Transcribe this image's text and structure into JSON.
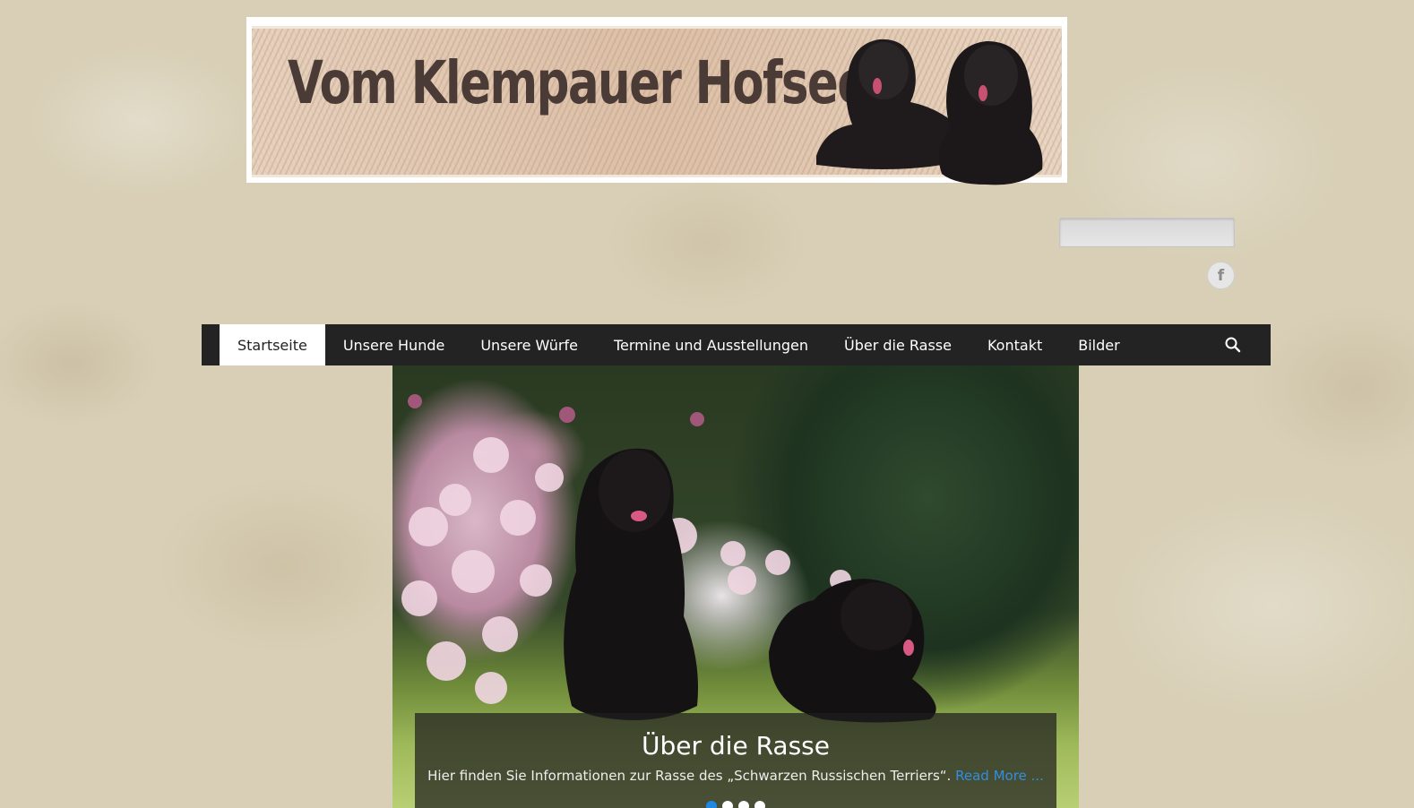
{
  "header": {
    "banner_title": "Vom Klempauer Hofsee",
    "logo": "dogs-banner-logo"
  },
  "search": {
    "placeholder": ""
  },
  "social": {
    "facebook_icon": "facebook-icon",
    "facebook_glyph": "f"
  },
  "nav": {
    "items": [
      {
        "label": "Startseite",
        "active": true
      },
      {
        "label": "Unsere Hunde"
      },
      {
        "label": "Unsere Würfe"
      },
      {
        "label": "Termine und Ausstellungen"
      },
      {
        "label": "Über die Rasse"
      },
      {
        "label": "Kontakt"
      },
      {
        "label": "Bilder"
      }
    ],
    "search_icon": "search-icon"
  },
  "slider": {
    "title": "Über die Rasse",
    "text": "Hier finden Sie Informationen zur Rasse des „Schwarzen Russischen Terriers“.",
    "link": "Read More ...",
    "slide_count": 4,
    "active_slide": 1
  },
  "colors": {
    "nav_bg": "#232323",
    "link": "#2f8fe0",
    "active_dot": "#1e88e5"
  }
}
